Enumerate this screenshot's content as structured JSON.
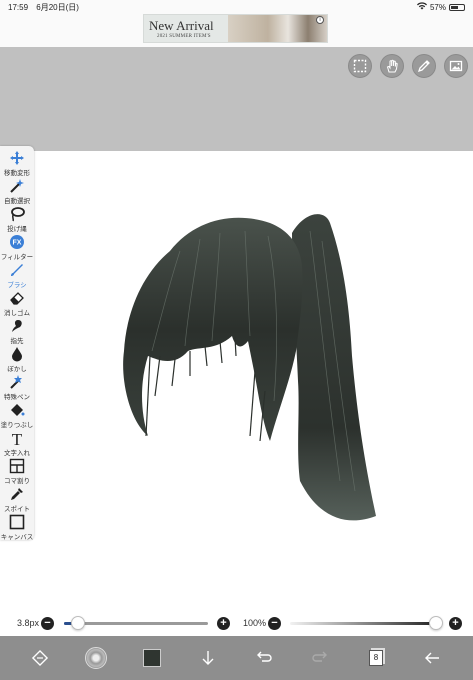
{
  "status_bar": {
    "time": "17:59",
    "date": "6月20日(日)",
    "battery_text": "57%",
    "battery_level": 0.57
  },
  "ad": {
    "title": "New Arrival",
    "subtitle": "2021 SUMMER ITEM'S",
    "info_icon": "info-icon"
  },
  "top_tools": [
    "selection-icon",
    "hand-icon",
    "pencil-icon",
    "image-icon"
  ],
  "toolbar": {
    "items": [
      {
        "icon": "move-icon",
        "label": "移動変形"
      },
      {
        "icon": "magic-wand-icon",
        "label": "自動選択"
      },
      {
        "icon": "lasso-icon",
        "label": "投げ縄"
      },
      {
        "icon": "fx-icon",
        "label": "フィルター"
      },
      {
        "icon": "brush-icon",
        "label": "ブラシ"
      },
      {
        "icon": "eraser-icon",
        "label": "消しゴム"
      },
      {
        "icon": "finger-icon",
        "label": "指先"
      },
      {
        "icon": "blur-icon",
        "label": "ぼかし"
      },
      {
        "icon": "special-pen-icon",
        "label": "特殊ペン"
      },
      {
        "icon": "fill-icon",
        "label": "塗りつぶし"
      },
      {
        "icon": "text-icon",
        "label": "文字入れ"
      },
      {
        "icon": "frame-icon",
        "label": "コマ割り"
      },
      {
        "icon": "eyedropper-icon",
        "label": "スポイト"
      },
      {
        "icon": "canvas-icon",
        "label": "キャンバス"
      }
    ],
    "active_index": 4
  },
  "fx_glyph": "FX",
  "text_glyph": "T",
  "brush_size": {
    "value": "3.8px",
    "level": 0.1,
    "minus": "−",
    "plus": "+"
  },
  "opacity": {
    "value": "100%",
    "level": 1.0,
    "minus": "−",
    "plus": "+"
  },
  "bottom_bar": {
    "items": [
      "transform-icon",
      "brush-preview",
      "color-swatch",
      "download-icon",
      "undo-icon",
      "redo-icon",
      "layers-icon",
      "back-icon"
    ],
    "layer_count": "8",
    "color": "#2f3530"
  },
  "colors": {
    "accent": "#3b7fd6",
    "canvas_bg": "#c0c0c0",
    "hair": "#2f3530"
  }
}
